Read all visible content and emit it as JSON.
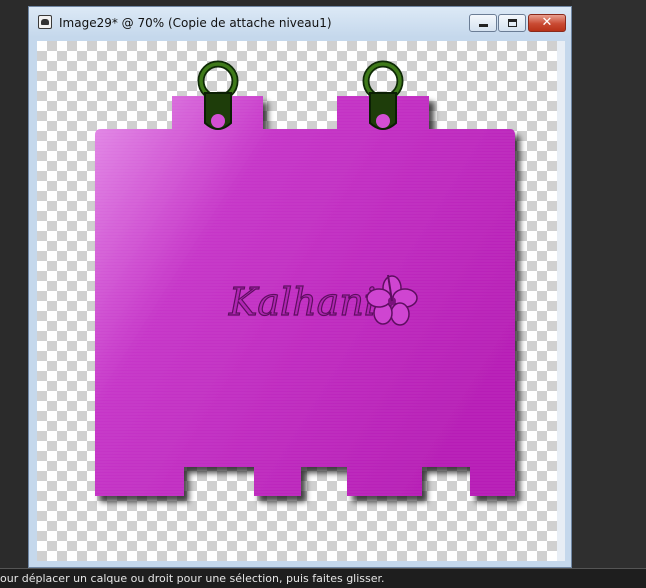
{
  "window": {
    "title": "Image29* @  70% (Copie de attache niveau1)",
    "buttons": {
      "minimize": "–",
      "maximize": "□",
      "close": "✕"
    }
  },
  "artwork": {
    "logo_text": "Kalhania",
    "logo_icon": "hibiscus-flower-icon",
    "colors": {
      "tag": "#c22fc2",
      "tag_light": "#e48ee8",
      "ring": "#2f5a12"
    }
  },
  "status": {
    "text": "our déplacer un calque ou droit pour une sélection, puis faites glisser."
  }
}
